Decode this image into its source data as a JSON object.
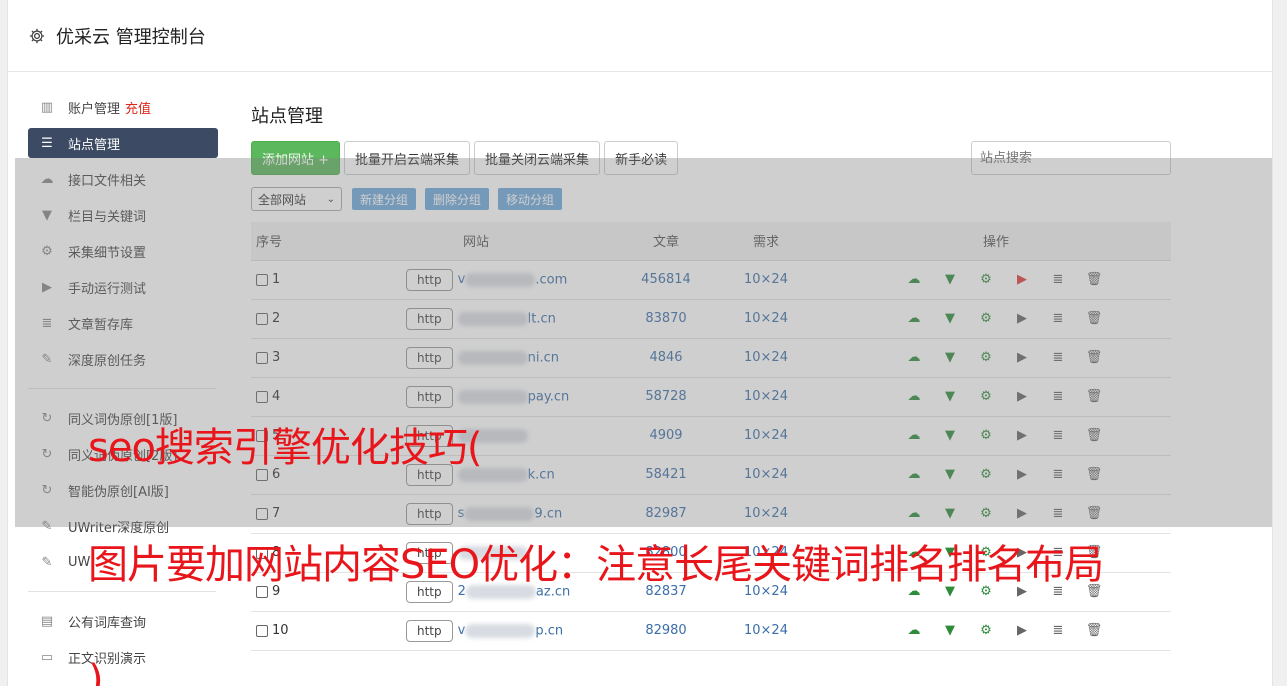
{
  "header": {
    "title": "优采云 管理控制台"
  },
  "sidebar": {
    "group1": [
      {
        "label": "账户管理",
        "accent": "充值",
        "icon": "bar-chart-icon"
      },
      {
        "label": "站点管理",
        "icon": "server-icon",
        "active": true
      },
      {
        "label": "接口文件相关",
        "icon": "cloud-upload-icon"
      },
      {
        "label": "栏目与关键词",
        "icon": "filter-icon"
      },
      {
        "label": "采集细节设置",
        "icon": "gears-icon"
      },
      {
        "label": "手动运行测试",
        "icon": "play-icon"
      },
      {
        "label": "文章暂存库",
        "icon": "database-icon"
      },
      {
        "label": "深度原创任务",
        "icon": "edit-icon"
      }
    ],
    "group2": [
      {
        "label": "同义词伪原创[1版]",
        "icon": "refresh-icon"
      },
      {
        "label": "同义词伪原创[2版]",
        "icon": "refresh-icon"
      },
      {
        "label": "智能伪原创[AI版]",
        "icon": "refresh-icon"
      },
      {
        "label": "UWriter深度原创",
        "icon": "edit-icon"
      },
      {
        "label": "UW",
        "icon": "edit-icon"
      }
    ],
    "group3": [
      {
        "label": "公有词库查询",
        "icon": "book-icon"
      },
      {
        "label": "正文识别演示",
        "icon": "monitor-icon"
      }
    ]
  },
  "main": {
    "title": "站点管理",
    "toolbar": {
      "add": "添加网站 +",
      "open_cloud": "批量开启云端采集",
      "close_cloud": "批量关闭云端采集",
      "guide": "新手必读",
      "search_placeholder": "站点搜索"
    },
    "filter": {
      "group_select": "全部网站",
      "new_group": "新建分组",
      "delete_group": "删除分组",
      "move_group": "移动分组"
    },
    "table": {
      "headers": {
        "no": "序号",
        "site": "网站",
        "articles": "文章",
        "demand": "需求",
        "ops": "操作"
      },
      "rows": [
        {
          "no": "1",
          "prefix": "v",
          "suffix": ".com",
          "articles": "456814",
          "demand": "10×24",
          "active_play": true
        },
        {
          "no": "2",
          "prefix": "",
          "suffix": "lt.cn",
          "articles": "83870",
          "demand": "10×24"
        },
        {
          "no": "3",
          "prefix": "",
          "suffix": "ni.cn",
          "articles": "4846",
          "demand": "10×24"
        },
        {
          "no": "4",
          "prefix": "",
          "suffix": "pay.cn",
          "articles": "58728",
          "demand": "10×24"
        },
        {
          "no": "5",
          "prefix": "",
          "suffix": "",
          "articles": "4909",
          "demand": "10×24"
        },
        {
          "no": "6",
          "prefix": "",
          "suffix": "k.cn",
          "articles": "58421",
          "demand": "10×24"
        },
        {
          "no": "7",
          "prefix": "s",
          "suffix": "9.cn",
          "articles": "82987",
          "demand": "10×24"
        },
        {
          "no": "8",
          "prefix": "",
          "suffix": "",
          "articles": "82800",
          "demand": "10×24"
        },
        {
          "no": "9",
          "prefix": "2",
          "suffix": "az.cn",
          "articles": "82837",
          "demand": "10×24"
        },
        {
          "no": "10",
          "prefix": "v",
          "suffix": "p.cn",
          "articles": "82980",
          "demand": "10×24"
        }
      ],
      "http_label": "http"
    }
  },
  "overlay": {
    "line1": "seo搜索引擎优化技巧(",
    "line2": "图片要加网站内容SEO优化：注意长尾关键词排名排名布局",
    "line3": ")"
  },
  "colors": {
    "sidebar_active": "#3c4a63",
    "green": "#5cb85c",
    "blue_btn": "#6fa8dc",
    "link": "#3b6ea8",
    "overlay_text": "#e8151b"
  }
}
